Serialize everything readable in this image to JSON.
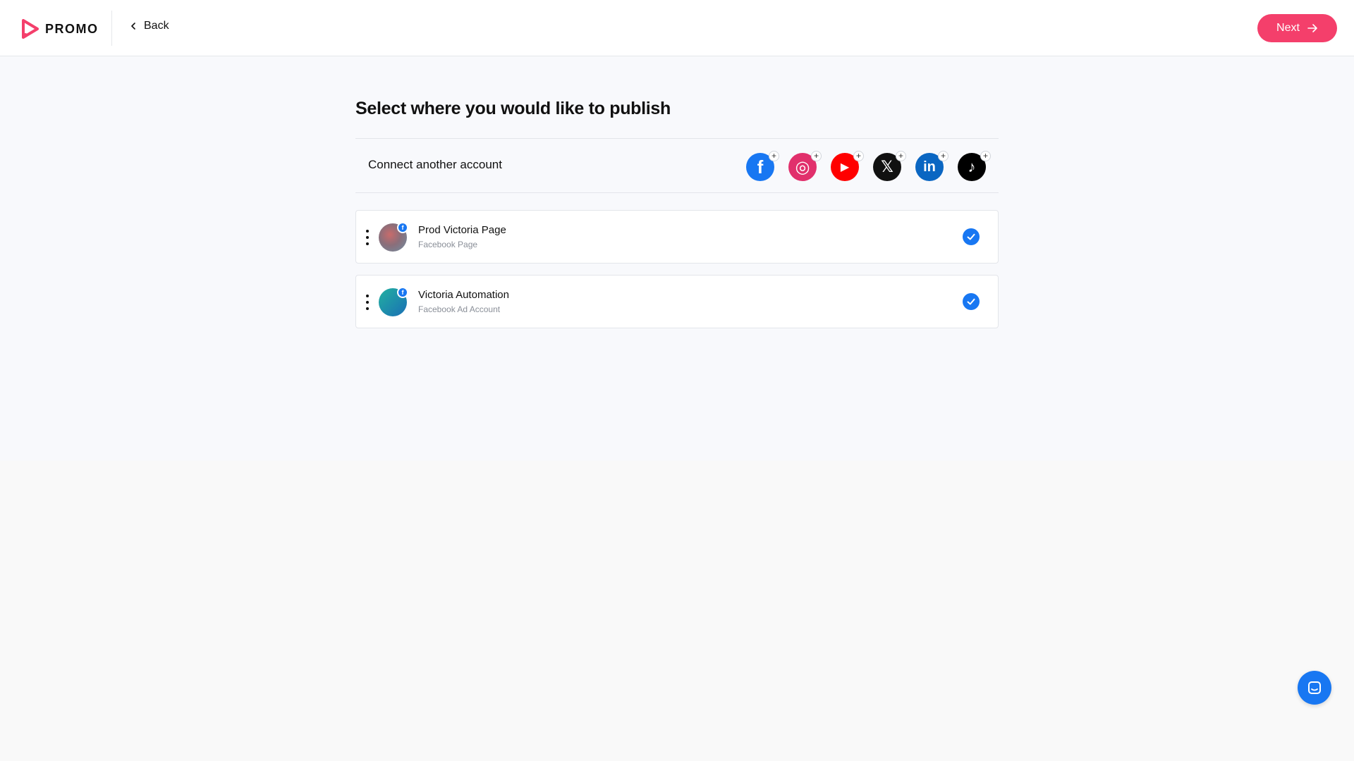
{
  "header": {
    "logo_text": "PROMO",
    "back_label": "Back",
    "next_label": "Next"
  },
  "page": {
    "title": "Select where you would like to publish"
  },
  "connect": {
    "label": "Connect another account",
    "platforms": [
      {
        "name": "facebook",
        "glyph": "f",
        "color": "#1877f2"
      },
      {
        "name": "instagram",
        "glyph": "◎",
        "color": "#e1306c"
      },
      {
        "name": "youtube",
        "glyph": "▶",
        "color": "#ff0000"
      },
      {
        "name": "x",
        "glyph": "𝕏",
        "color": "#111111"
      },
      {
        "name": "linkedin",
        "glyph": "in",
        "color": "#0a66c2"
      },
      {
        "name": "tiktok",
        "glyph": "♪",
        "color": "#000000"
      }
    ],
    "plus_glyph": "+"
  },
  "accounts": [
    {
      "name": "Prod Victoria Page",
      "type": "Facebook Page",
      "selected": true,
      "badge": "f"
    },
    {
      "name": "Victoria Automation",
      "type": "Facebook Ad Account",
      "selected": true,
      "badge": "f"
    }
  ],
  "colors": {
    "accent": "#f43f6b",
    "selected": "#1877f2"
  },
  "icons": {
    "back": "chevron-left-icon",
    "next": "arrow-right-icon",
    "check": "check-icon",
    "menu": "kebab-icon",
    "chat": "chat-icon"
  }
}
